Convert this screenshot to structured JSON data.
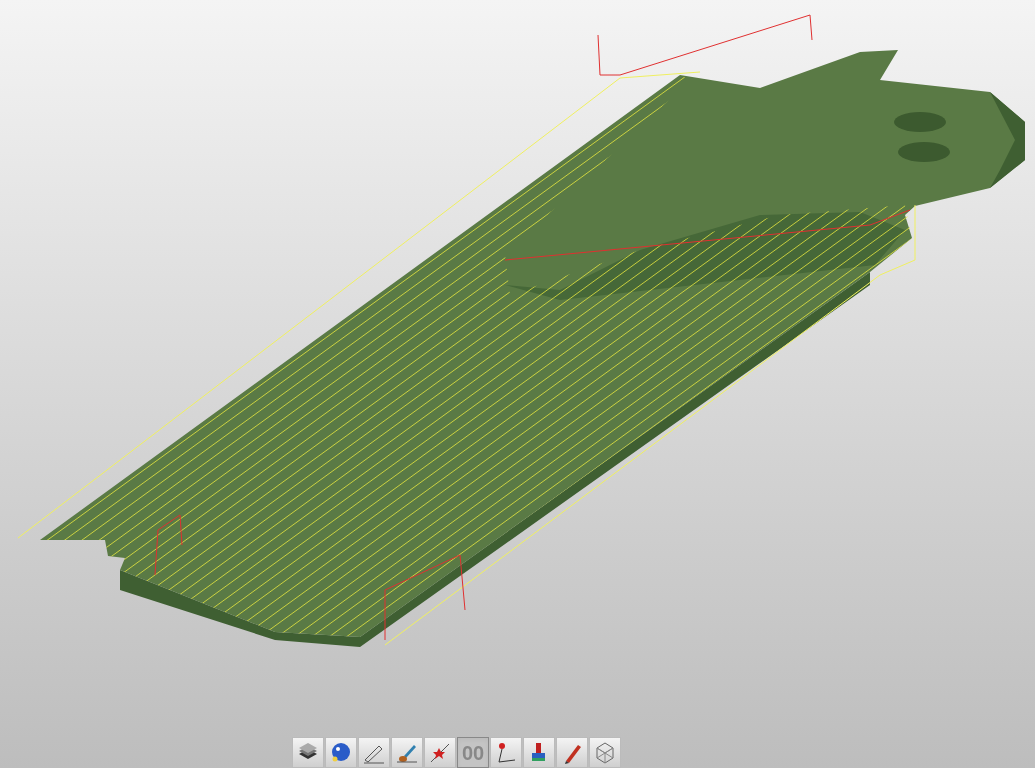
{
  "toolbar": {
    "buttons": [
      {
        "kind": "layers",
        "selected": false
      },
      {
        "kind": "globe",
        "selected": false
      },
      {
        "kind": "pen",
        "selected": false
      },
      {
        "kind": "brush",
        "selected": false
      },
      {
        "kind": "star",
        "selected": false
      },
      {
        "kind": "digits",
        "label": "00",
        "selected": true
      },
      {
        "kind": "probe",
        "selected": false
      },
      {
        "kind": "stamp",
        "selected": false
      },
      {
        "kind": "pencil",
        "selected": false
      },
      {
        "kind": "mesh",
        "selected": false
      }
    ]
  }
}
